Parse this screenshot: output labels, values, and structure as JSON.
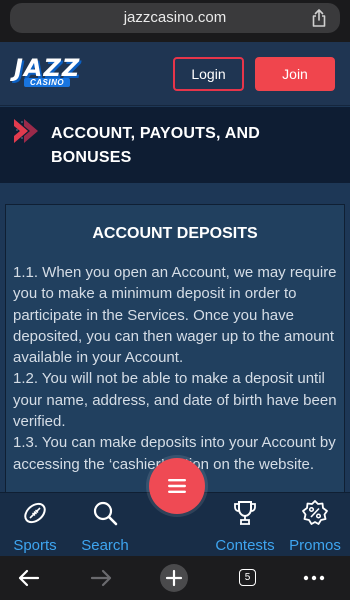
{
  "browser": {
    "url": "jazzcasino.com",
    "tabs_count": "5"
  },
  "header": {
    "logo": {
      "word": "JAZZ",
      "sub": "CASINO"
    },
    "login_label": "Login",
    "join_label": "Join"
  },
  "section": {
    "title": "ACCOUNT, PAYOUTS, AND BONUSES"
  },
  "card": {
    "title": "ACCOUNT DEPOSITS",
    "paragraphs": [
      "1.1. When you open an Account, we may require you to make a minimum deposit in order to participate in the Services. Once you have deposited, you can then wager up to the amount available in your Account.",
      "1.2. You will not be able to make a deposit until your name, address, and date of birth have been verified.",
      "1.3. You can make deposits into your Account by accessing the ‘cashier’ option on the website."
    ]
  },
  "bottom_nav": {
    "items": [
      {
        "label": "Sports",
        "icon": "football-icon"
      },
      {
        "label": "Search",
        "icon": "search-icon"
      },
      {
        "label": "Contests",
        "icon": "trophy-icon"
      },
      {
        "label": "Promos",
        "icon": "percent-badge-icon"
      }
    ],
    "menu_icon": "hamburger-menu-icon"
  },
  "colors": {
    "accent_red": "#f0454d",
    "nav_blue": "#3ea5f0",
    "page_bg": "#1d3756",
    "banner_bg": "#0e1d33"
  }
}
